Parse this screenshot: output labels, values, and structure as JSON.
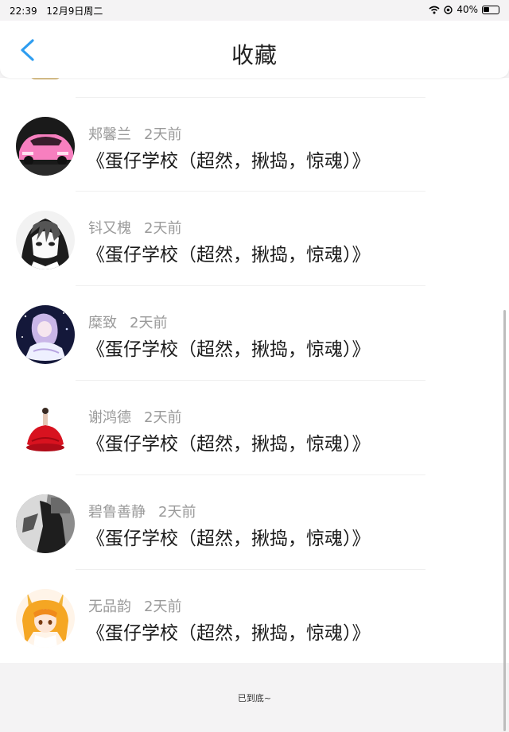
{
  "status": {
    "time": "22:39",
    "date": "12月9日周二",
    "battery": "40%",
    "icons": [
      "wifi-icon",
      "location-icon",
      "battery-icon"
    ]
  },
  "header": {
    "title": "收藏",
    "back_icon": "chevron-left-icon",
    "accent_color": "#2e9df0"
  },
  "favorites": [
    {
      "author": "郏馨兰",
      "time": "2天前",
      "title": "《蛋仔学校（超然，揪捣，惊魂）》",
      "avatar": "pink-car-avatar"
    },
    {
      "author": "钭又槐",
      "time": "2天前",
      "title": "《蛋仔学校（超然，揪捣，惊魂）》",
      "avatar": "anime-boy-avatar"
    },
    {
      "author": "糜致",
      "time": "2天前",
      "title": "《蛋仔学校（超然，揪捣，惊魂）》",
      "avatar": "anime-girl-purple-avatar"
    },
    {
      "author": "谢鸿德",
      "time": "2天前",
      "title": "《蛋仔学校（超然，揪捣，惊魂）》",
      "avatar": "red-dress-avatar"
    },
    {
      "author": "碧鲁善静",
      "time": "2天前",
      "title": "《蛋仔学校（超然，揪捣，惊魂）》",
      "avatar": "dark-photo-avatar"
    },
    {
      "author": "无品韵",
      "time": "2天前",
      "title": "《蛋仔学校（超然，揪捣，惊魂）》",
      "avatar": "anime-girl-orange-avatar"
    }
  ],
  "footer": {
    "end_text": "已到底~"
  }
}
